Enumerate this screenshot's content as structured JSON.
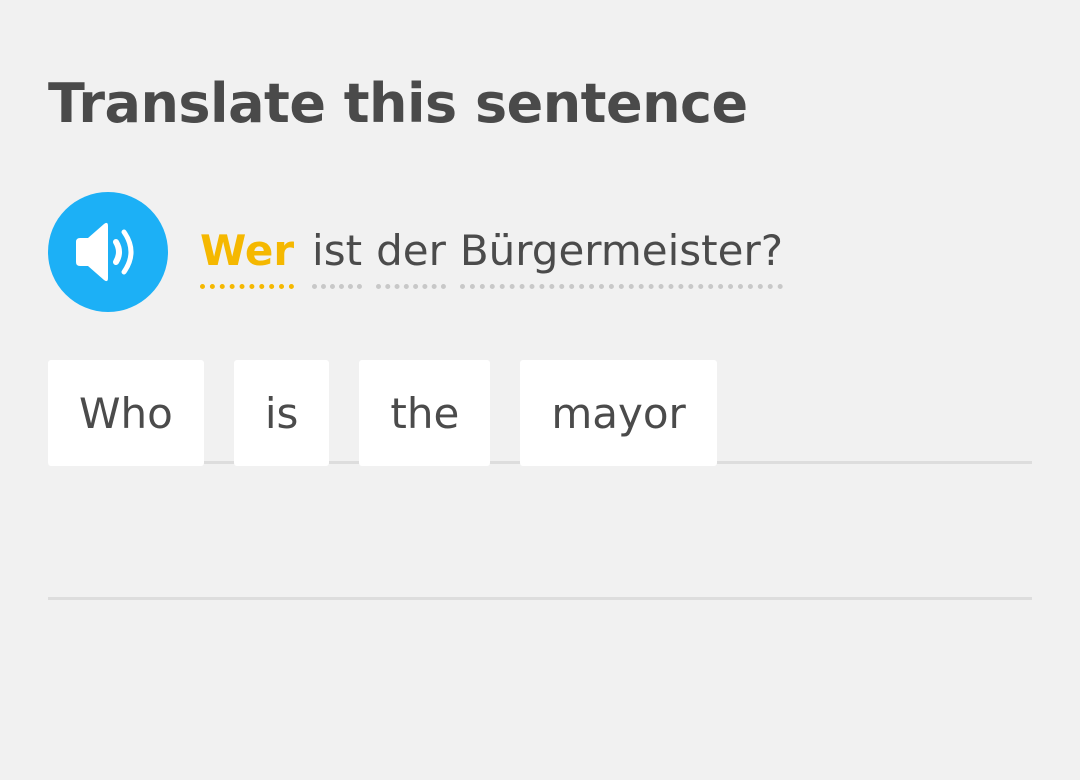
{
  "prompt": {
    "title": "Translate this sentence"
  },
  "audio": {
    "icon": "speaker-icon",
    "color": "#1cb0f6"
  },
  "sentence": {
    "words": [
      "Wer",
      "ist",
      "der",
      "Bürgermeister?"
    ],
    "new_word_color": "#f5b800"
  },
  "answer": {
    "tokens": [
      "Who",
      "is",
      "the",
      "mayor"
    ]
  }
}
